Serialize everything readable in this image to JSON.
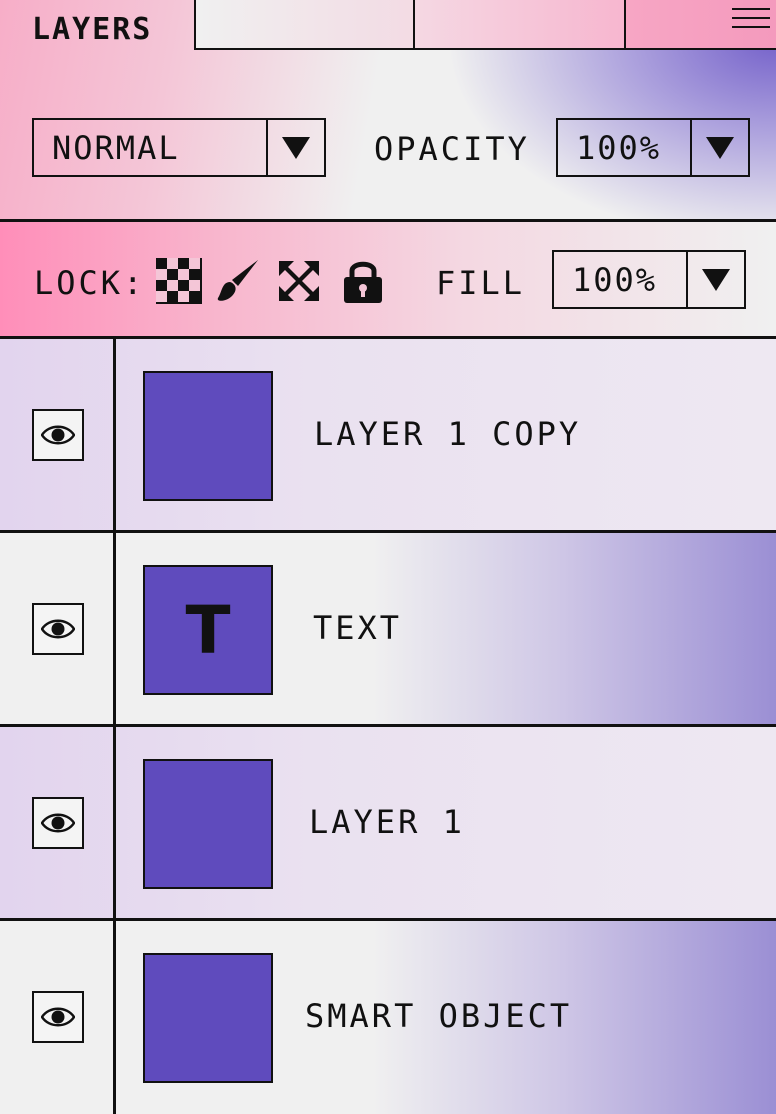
{
  "panel": {
    "active_tab": "LAYERS",
    "blend_mode": "NORMAL",
    "opacity_label": "OPACITY",
    "opacity_value": "100%",
    "lock_label": "LOCK:",
    "fill_label": "FILL",
    "fill_value": "100%"
  },
  "lock_icons": [
    "transparency-checker-icon",
    "brush-icon",
    "move-arrows-icon",
    "padlock-icon"
  ],
  "layers": [
    {
      "name": "LAYER 1 COPY",
      "thumb_glyph": ""
    },
    {
      "name": "TEXT",
      "thumb_glyph": "T"
    },
    {
      "name": "LAYER 1",
      "thumb_glyph": ""
    },
    {
      "name": "SMART OBJECT",
      "thumb_glyph": ""
    }
  ],
  "colors": {
    "thumbnail": "#5f4bbd",
    "accent_pink": "#ff8eb9",
    "accent_purple": "#6e5ac8"
  }
}
